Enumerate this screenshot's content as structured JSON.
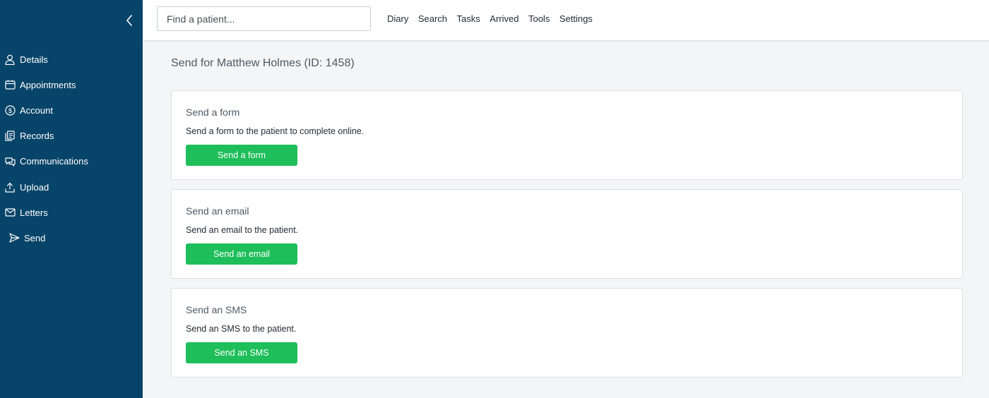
{
  "sidebar": {
    "items": [
      {
        "label": "Details",
        "icon": "user-icon"
      },
      {
        "label": "Appointments",
        "icon": "calendar-icon"
      },
      {
        "label": "Account",
        "icon": "dollar-icon"
      },
      {
        "label": "Records",
        "icon": "records-icon"
      },
      {
        "label": "Communications",
        "icon": "chat-icon"
      },
      {
        "label": "Upload",
        "icon": "upload-icon"
      },
      {
        "label": "Letters",
        "icon": "envelope-icon"
      },
      {
        "label": "Send",
        "icon": "send-icon"
      }
    ]
  },
  "header": {
    "search_placeholder": "Find a patient...",
    "nav": [
      "Diary",
      "Search",
      "Tasks",
      "Arrived",
      "Tools",
      "Settings"
    ]
  },
  "main": {
    "title": "Send for Matthew Holmes (ID: 1458)",
    "cards": [
      {
        "title": "Send a form",
        "description": "Send a form to the patient to complete online.",
        "button": "Send a form"
      },
      {
        "title": "Send an email",
        "description": "Send an email to the patient.",
        "button": "Send an email"
      },
      {
        "title": "Send an SMS",
        "description": "Send an SMS to the patient.",
        "button": "Send an SMS"
      }
    ]
  },
  "colors": {
    "sidebar_bg": "#074469",
    "button_green": "#1ebe5a",
    "page_bg": "#f4f5f6"
  }
}
